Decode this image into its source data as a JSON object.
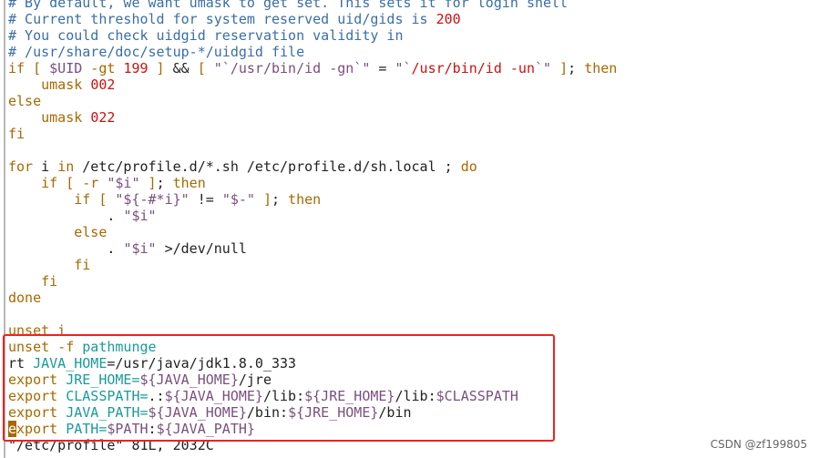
{
  "editor": {
    "lines": [
      [
        [
          "# By default, we want umask to get set. This sets it for login shell",
          "comment"
        ]
      ],
      [
        [
          "# Current threshold for system reserved uid/gids is ",
          "comment"
        ],
        [
          "200",
          "number"
        ]
      ],
      [
        [
          "# You could check uidgid reservation validity in",
          "comment"
        ]
      ],
      [
        [
          "# /usr/share/doc/setup-*/uidgid file",
          "comment"
        ]
      ],
      [
        [
          "if [ ",
          "keyword"
        ],
        [
          "$UID",
          "string"
        ],
        [
          " -gt ",
          "keyword"
        ],
        [
          "199",
          "number"
        ],
        [
          " ]",
          "keyword"
        ],
        [
          " && ",
          "plain"
        ],
        [
          "[ ",
          "keyword"
        ],
        [
          "\"`/usr/bin/id -gn`\"",
          "string"
        ],
        [
          " = ",
          "plain"
        ],
        [
          "\"`",
          "string"
        ],
        [
          "/usr/bin/id -un",
          "red"
        ],
        [
          "`\"",
          "string"
        ],
        [
          " ]",
          "keyword"
        ],
        [
          "; ",
          "plain"
        ],
        [
          "then",
          "keyword"
        ]
      ],
      [
        [
          "    umask ",
          "keyword"
        ],
        [
          "002",
          "number"
        ]
      ],
      [
        [
          "else",
          "keyword"
        ]
      ],
      [
        [
          "    umask ",
          "keyword"
        ],
        [
          "022",
          "number"
        ]
      ],
      [
        [
          "fi",
          "keyword"
        ]
      ],
      [
        [
          "",
          "plain"
        ]
      ],
      [
        [
          "for",
          "keyword"
        ],
        [
          " i ",
          "plain"
        ],
        [
          "in",
          "keyword"
        ],
        [
          " /etc/profile.d/*.sh /etc/profile.d/sh.local ; ",
          "plain"
        ],
        [
          "do",
          "keyword"
        ]
      ],
      [
        [
          "    if [ -r ",
          "keyword"
        ],
        [
          "\"$i\"",
          "string"
        ],
        [
          " ]",
          "keyword"
        ],
        [
          "; ",
          "plain"
        ],
        [
          "then",
          "keyword"
        ]
      ],
      [
        [
          "        if [ ",
          "keyword"
        ],
        [
          "\"${-#*i}\"",
          "string"
        ],
        [
          " != ",
          "plain"
        ],
        [
          "\"$-\"",
          "string"
        ],
        [
          " ]",
          "keyword"
        ],
        [
          "; ",
          "plain"
        ],
        [
          "then",
          "keyword"
        ]
      ],
      [
        [
          "            . ",
          "plain"
        ],
        [
          "\"$i\"",
          "string"
        ]
      ],
      [
        [
          "        else",
          "keyword"
        ]
      ],
      [
        [
          "            . ",
          "plain"
        ],
        [
          "\"$i\"",
          "string"
        ],
        [
          " >/dev/null",
          "plain"
        ]
      ],
      [
        [
          "        fi",
          "keyword"
        ]
      ],
      [
        [
          "    fi",
          "keyword"
        ]
      ],
      [
        [
          "done",
          "keyword"
        ]
      ],
      [
        [
          "",
          "plain"
        ]
      ],
      [
        [
          "unset i",
          "keyword"
        ]
      ],
      [
        [
          "unset -f ",
          "keyword"
        ],
        [
          "pathmunge",
          "var"
        ]
      ],
      [
        [
          "rt ",
          "plain"
        ],
        [
          "JAVA_HOME",
          "var"
        ],
        [
          "=/usr/java/jdk1.8.0_333",
          "plain"
        ]
      ],
      [
        [
          "export ",
          "keyword"
        ],
        [
          "JRE_HOME=",
          "var"
        ],
        [
          "${JAVA_HOME}",
          "string"
        ],
        [
          "/jre",
          "plain"
        ]
      ],
      [
        [
          "export ",
          "keyword"
        ],
        [
          "CLASSPATH=",
          "var"
        ],
        [
          ".:",
          "plain"
        ],
        [
          "${JAVA_HOME}",
          "string"
        ],
        [
          "/lib:",
          "plain"
        ],
        [
          "${JRE_HOME}",
          "string"
        ],
        [
          "/lib:",
          "plain"
        ],
        [
          "$CLASSPATH",
          "string"
        ]
      ],
      [
        [
          "export ",
          "keyword"
        ],
        [
          "JAVA_PATH=",
          "var"
        ],
        [
          "${JAVA_HOME}",
          "string"
        ],
        [
          "/bin:",
          "plain"
        ],
        [
          "${JRE_HOME}",
          "string"
        ],
        [
          "/bin",
          "plain"
        ]
      ],
      [
        [
          "e",
          "cursor"
        ],
        [
          "xport ",
          "keyword"
        ],
        [
          "PATH=",
          "var"
        ],
        [
          "$PATH",
          "string"
        ],
        [
          ":",
          "plain"
        ],
        [
          "${JAVA_PATH}",
          "string"
        ]
      ],
      [
        [
          "\"/etc/profile\" 81L, 2032C",
          "plain"
        ]
      ]
    ]
  },
  "watermark": "CSDN @zf199805",
  "colors": {
    "highlight_box": "#ee2222",
    "comment": "#3a6ea8",
    "keyword": "#a86800",
    "variable": "#1a9a9a",
    "string": "#7a4f7e",
    "number": "#cc1010"
  }
}
